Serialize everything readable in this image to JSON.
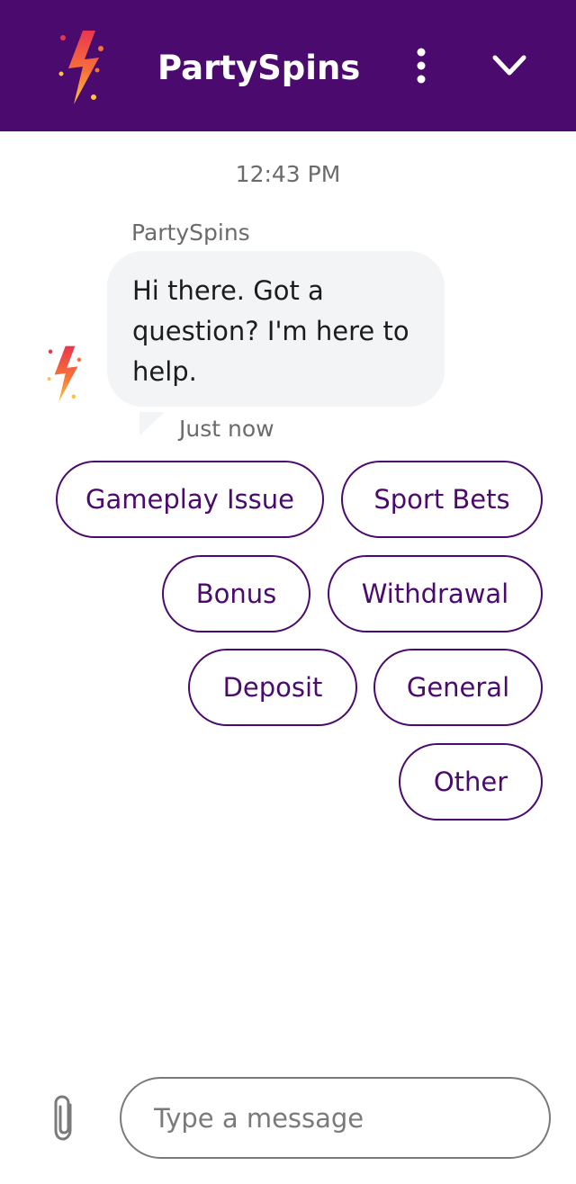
{
  "header": {
    "title": "PartySpins",
    "logo_icon": "lightning-bolt-logo",
    "menu_icon": "vertical-ellipsis-icon",
    "collapse_icon": "chevron-down-icon",
    "background_color": "#4a0a6e"
  },
  "conversation": {
    "timestamp": "12:43 PM",
    "messages": [
      {
        "sender": "PartySpins",
        "text": "Hi there. Got a question? I'm here to help.",
        "time": "Just now",
        "avatar_icon": "lightning-bolt-logo"
      }
    ]
  },
  "quick_replies": [
    {
      "label": "Gameplay Issue"
    },
    {
      "label": "Sport Bets"
    },
    {
      "label": "Bonus"
    },
    {
      "label": "Withdrawal"
    },
    {
      "label": "Deposit"
    },
    {
      "label": "General"
    },
    {
      "label": "Other"
    }
  ],
  "composer": {
    "placeholder": "Type a message",
    "attach_icon": "paperclip-icon"
  }
}
